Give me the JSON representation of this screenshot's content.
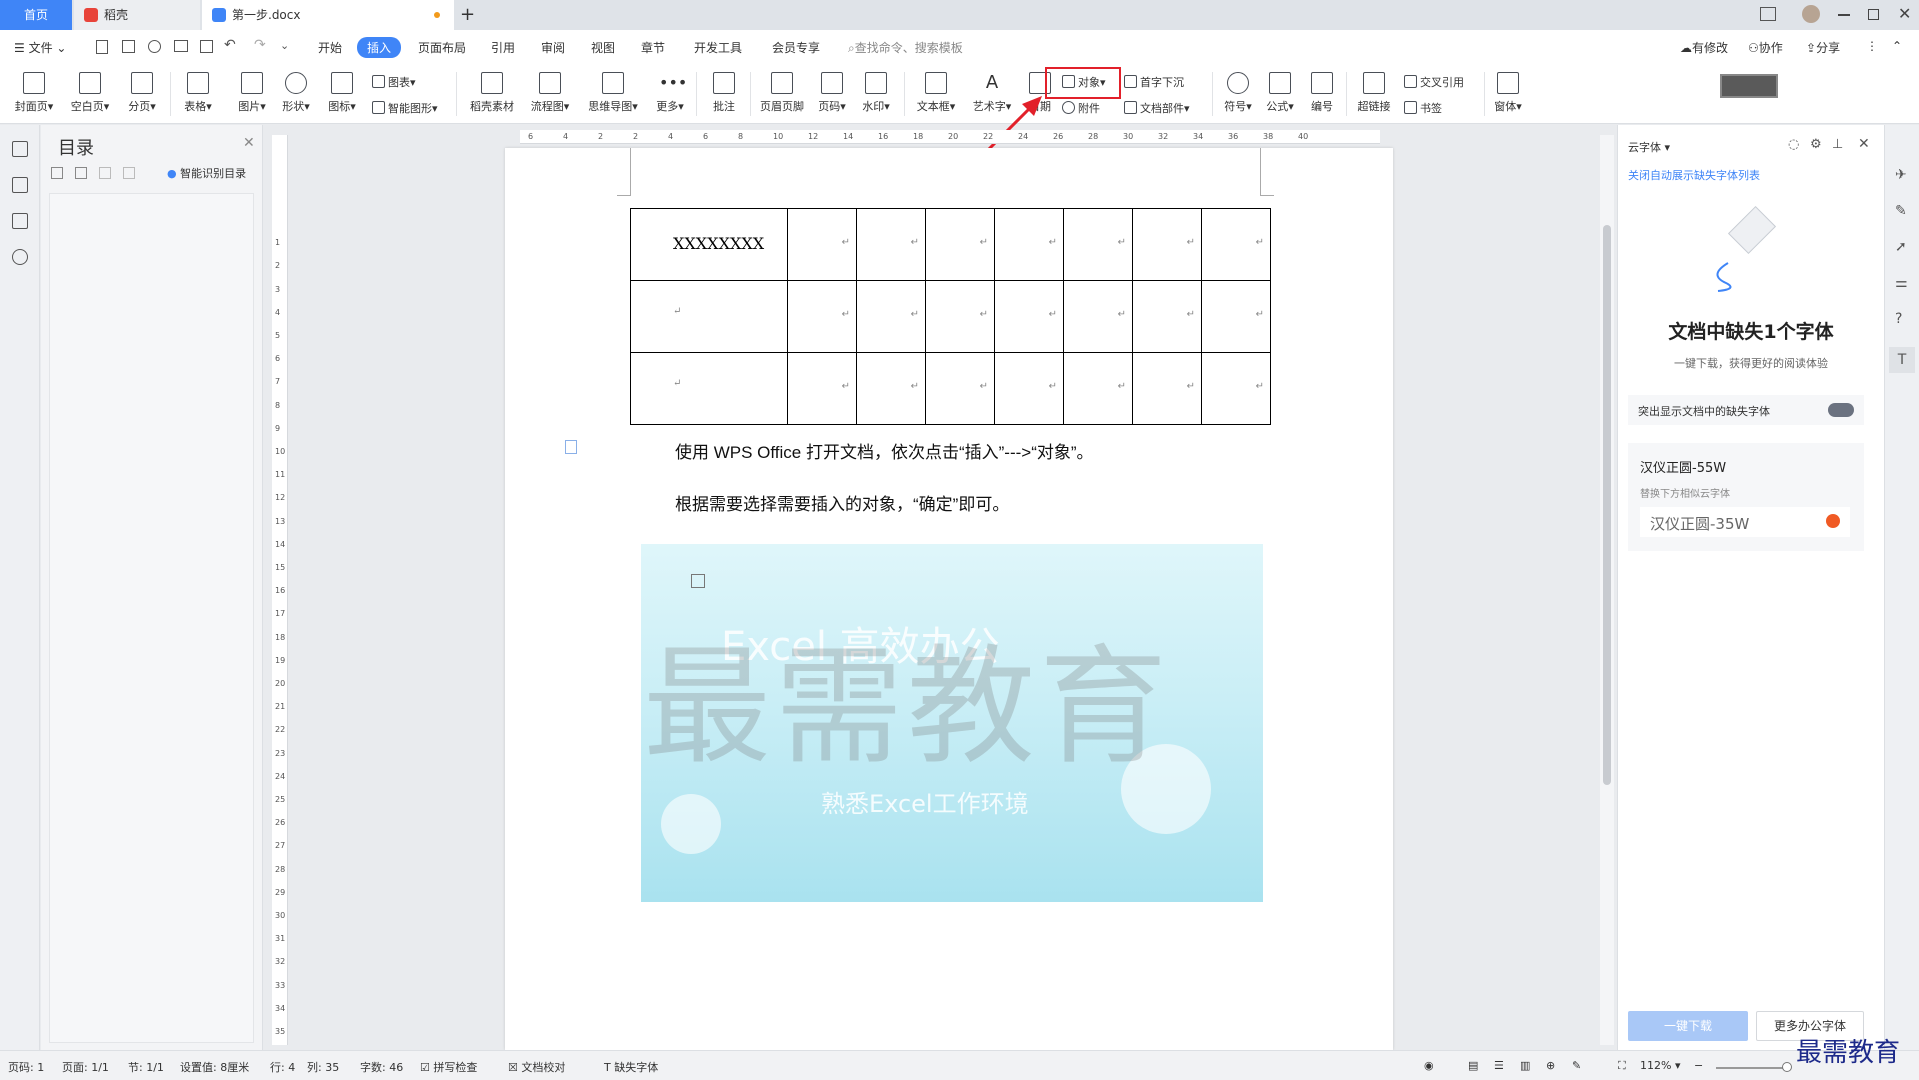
{
  "tabs": {
    "home": "首页",
    "wps": "稻壳",
    "doc": "第一步.docx",
    "add": "+"
  },
  "menu": {
    "file": "文件",
    "items": [
      "开始",
      "插入",
      "页面布局",
      "引用",
      "审阅",
      "视图",
      "章节",
      "开发工具",
      "会员专享"
    ],
    "search": "查找命令、搜索模板",
    "right": [
      "有修改",
      "协作",
      "分享"
    ]
  },
  "ribbon": {
    "big": [
      "封面页",
      "空白页",
      "分页",
      "表格",
      "图片",
      "形状",
      "图标",
      "稻壳素材",
      "流程图",
      "思维导图",
      "更多",
      "批注",
      "页眉页脚",
      "页码",
      "水印",
      "文本框",
      "艺术字",
      "日期",
      "符号",
      "公式",
      "编号",
      "超链接",
      "窗体"
    ],
    "small": {
      "chart": "图表",
      "smartart": "智能图形",
      "object": "对象",
      "attach": "附件",
      "dropcap": "首字下沉",
      "docpart": "文档部件",
      "crossref": "交叉引用",
      "bookmark": "书签"
    }
  },
  "toc": {
    "title": "目录",
    "smart": "智能识别目录"
  },
  "document": {
    "table_first_cell": "XXXXXXXX",
    "para1": "使用 WPS Office 打开文档，依次点击“插入”--->“对象”。",
    "para2": "根据需要选择需要插入的对象，“确定”即可。",
    "watermark": "最需教育",
    "banner_line1": "Excel 高效办公",
    "banner_line2": "熟悉Excel工作环境"
  },
  "rightpanel": {
    "header": "云字体",
    "link": "关闭自动展示缺失字体列表",
    "title": "文档中缺失1个字体",
    "subtitle": "一键下载，获得更好的阅读体验",
    "toggle_label": "突出显示文档中的缺失字体",
    "font_missing": "汉仪正圆-55W",
    "replace_hint": "替换下方相似云字体",
    "font_replace": "汉仪正圆-35W",
    "download_btn": "一键下载",
    "more_btn": "更多办公字体"
  },
  "status": {
    "page": "页码: 1",
    "pages": "页面: 1/1",
    "section": "节: 1/1",
    "setting": "设置值: 8厘米",
    "row": "行: 4",
    "col": "列: 35",
    "words": "字数: 46",
    "spell": "拼写检查",
    "proof": "文档校对",
    "missing": "缺失字体",
    "zoom": "112%"
  },
  "corner_logo": "最需教育",
  "colors": {
    "accent": "#3f85f7",
    "annotation": "#e2202a"
  }
}
